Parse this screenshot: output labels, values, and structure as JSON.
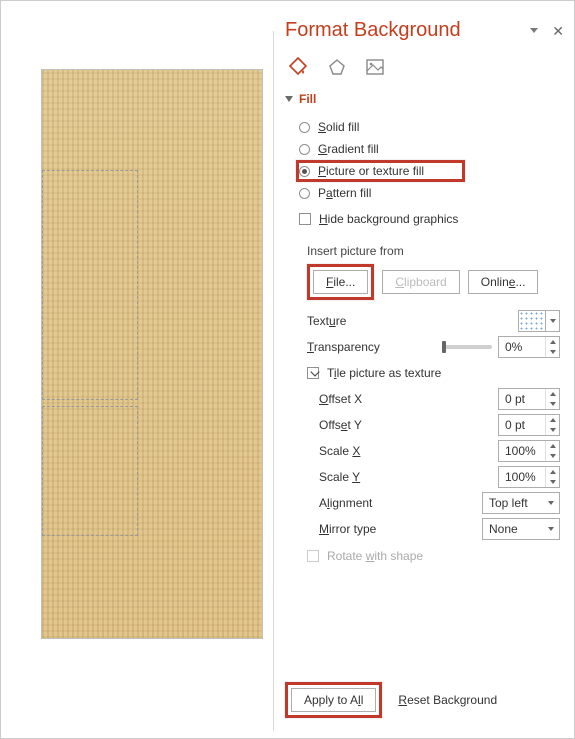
{
  "pane_title": "Format Background",
  "fill": {
    "section_label": "Fill",
    "options": {
      "solid": {
        "text_pre": "",
        "u": "S",
        "text_post": "olid fill"
      },
      "gradient": {
        "text_pre": "",
        "u": "G",
        "text_post": "radient fill"
      },
      "picture": {
        "text_pre": "",
        "u": "P",
        "text_post": "icture or texture fill"
      },
      "pattern": {
        "text_pre": "P",
        "u": "a",
        "text_post": "ttern fill"
      }
    },
    "selected": "picture",
    "hide_bg": {
      "text_pre": "",
      "u": "H",
      "text_post": "ide background graphics",
      "checked": false
    }
  },
  "insert": {
    "label": "Insert picture from",
    "file_btn": {
      "u": "F",
      "rest": "ile..."
    },
    "clipboard": {
      "u": "C",
      "rest": "lipboard"
    },
    "online_btn": {
      "pre": "Onlin",
      "u": "e",
      "rest": "..."
    }
  },
  "texture": {
    "label_pre": "Text",
    "label_u": "u",
    "label_post": "re"
  },
  "transparency": {
    "label_pre": "",
    "label_u": "T",
    "label_post": "ransparency",
    "value": "0%"
  },
  "tile": {
    "label_pre": "T",
    "label_u": "i",
    "label_post": "le picture as texture",
    "checked": true
  },
  "offsets": {
    "x": {
      "label_pre": "",
      "label_u": "O",
      "label_post": "ffset X",
      "value": "0 pt"
    },
    "y": {
      "label_pre": "Offs",
      "label_u": "e",
      "label_post": "t Y",
      "value": "0 pt"
    },
    "sx": {
      "label_pre": "Scale ",
      "label_u": "X",
      "label_post": "",
      "value": "100%"
    },
    "sy": {
      "label_pre": "Scale ",
      "label_u": "Y",
      "label_post": "",
      "value": "100%"
    }
  },
  "alignment": {
    "label_pre": "A",
    "label_u": "l",
    "label_post": "ignment",
    "value": "Top left"
  },
  "mirror": {
    "label_pre": "",
    "label_u": "M",
    "label_post": "irror type",
    "value": "None"
  },
  "rotate": {
    "label_pre": "Rotate ",
    "label_u": "w",
    "label_post": "ith shape"
  },
  "footer": {
    "apply_all_pre": "Apply to A",
    "apply_all_u": "l",
    "apply_all_post": "l",
    "reset_pre": "",
    "reset_u": "R",
    "reset_post": "eset Background"
  }
}
